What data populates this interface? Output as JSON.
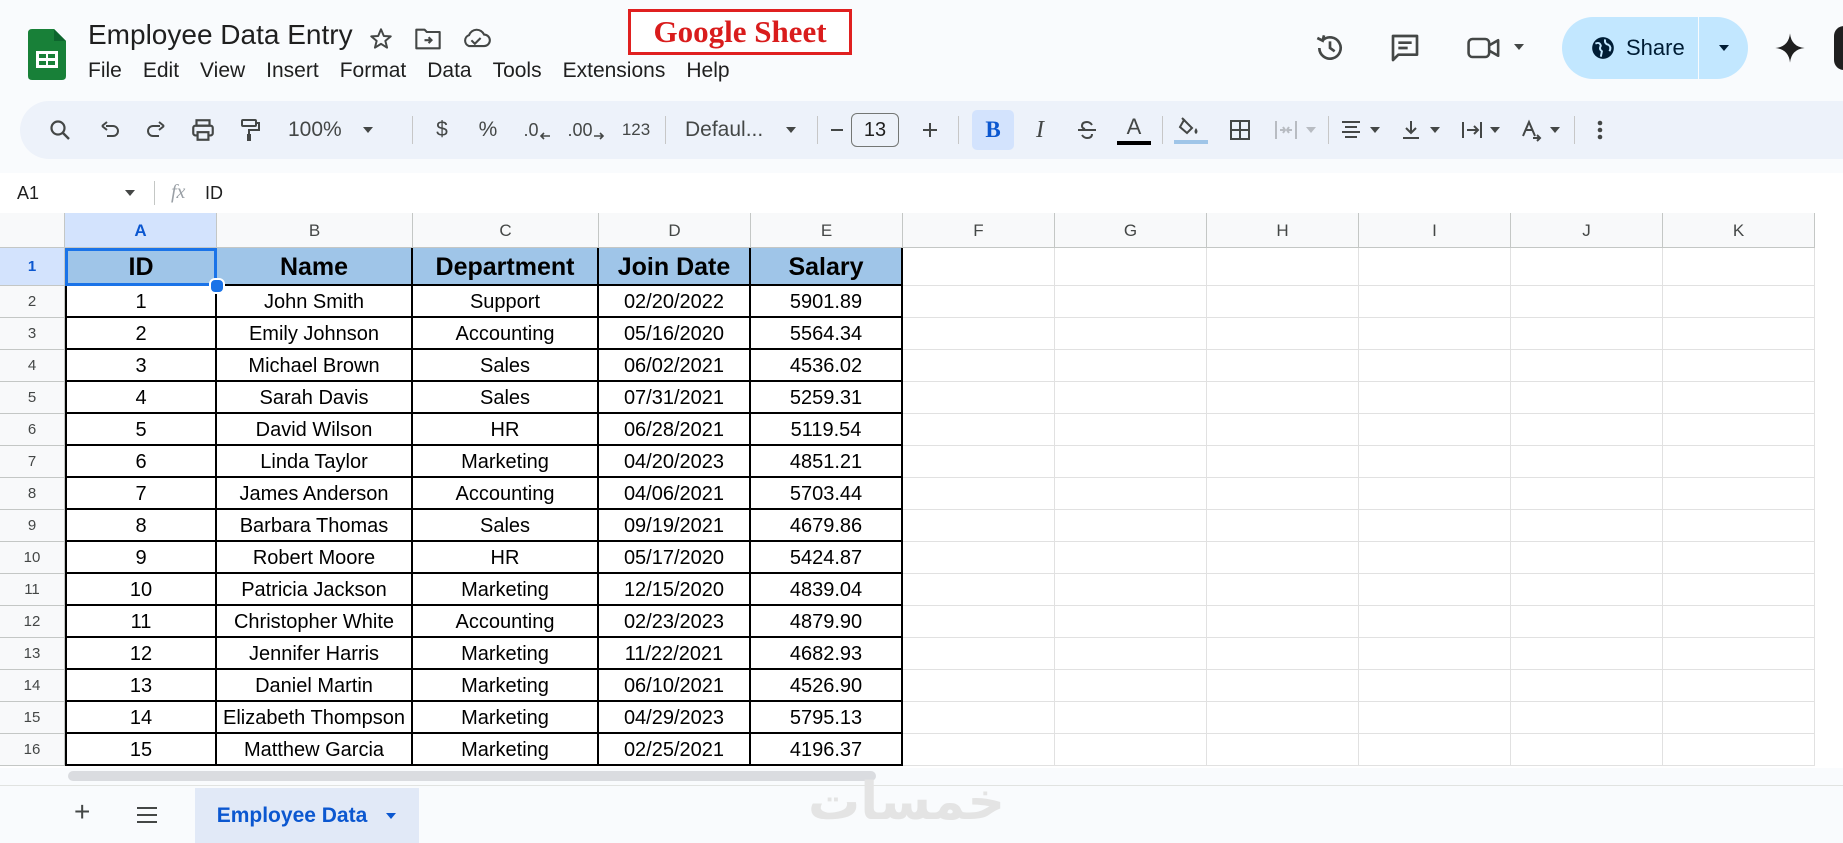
{
  "app": {
    "title": "Employee Data Entry",
    "menu": [
      "File",
      "Edit",
      "View",
      "Insert",
      "Format",
      "Data",
      "Tools",
      "Extensions",
      "Help"
    ],
    "overlay_label": "Google Sheet",
    "share_label": "Share",
    "brand_color": "#188038",
    "accent_color": "#0b57d0"
  },
  "toolbar": {
    "zoom": "100%",
    "currency": "$",
    "percent": "%",
    "decrease_decimal": ".0",
    "increase_decimal": ".00",
    "number_format": "123",
    "font": "Defaul...",
    "font_size": "13",
    "bold": "B",
    "italic": "I",
    "text_color_glyph": "A",
    "icons": [
      "search-icon",
      "undo-icon",
      "redo-icon",
      "print-icon",
      "paint-format-icon",
      "strikethrough-icon",
      "fill-color-icon",
      "borders-icon",
      "merge-icon",
      "align-icon",
      "valign-icon",
      "wrap-icon",
      "rotate-icon",
      "more-icon"
    ]
  },
  "formula_bar": {
    "cell_ref": "A1",
    "fx": "fx",
    "value": "ID"
  },
  "grid": {
    "columns": [
      "A",
      "B",
      "C",
      "D",
      "E",
      "F",
      "G",
      "H",
      "I",
      "J",
      "K"
    ],
    "rows": [
      "1",
      "2",
      "3",
      "4",
      "5",
      "6",
      "7",
      "8",
      "9",
      "10",
      "11",
      "12",
      "13",
      "14",
      "15",
      "16"
    ],
    "headers": [
      "ID",
      "Name",
      "Department",
      "Join Date",
      "Salary"
    ],
    "data": [
      [
        "1",
        "John Smith",
        "Support",
        "02/20/2022",
        "5901.89"
      ],
      [
        "2",
        "Emily Johnson",
        "Accounting",
        "05/16/2020",
        "5564.34"
      ],
      [
        "3",
        "Michael Brown",
        "Sales",
        "06/02/2021",
        "4536.02"
      ],
      [
        "4",
        "Sarah Davis",
        "Sales",
        "07/31/2021",
        "5259.31"
      ],
      [
        "5",
        "David Wilson",
        "HR",
        "06/28/2021",
        "5119.54"
      ],
      [
        "6",
        "Linda Taylor",
        "Marketing",
        "04/20/2023",
        "4851.21"
      ],
      [
        "7",
        "James Anderson",
        "Accounting",
        "04/06/2021",
        "5703.44"
      ],
      [
        "8",
        "Barbara Thomas",
        "Sales",
        "09/19/2021",
        "4679.86"
      ],
      [
        "9",
        "Robert Moore",
        "HR",
        "05/17/2020",
        "5424.87"
      ],
      [
        "10",
        "Patricia Jackson",
        "Marketing",
        "12/15/2020",
        "4839.04"
      ],
      [
        "11",
        "Christopher White",
        "Accounting",
        "02/23/2023",
        "4879.90"
      ],
      [
        "12",
        "Jennifer Harris",
        "Marketing",
        "11/22/2021",
        "4682.93"
      ],
      [
        "13",
        "Daniel Martin",
        "Marketing",
        "06/10/2021",
        "4526.90"
      ],
      [
        "14",
        "Elizabeth Thompson",
        "Marketing",
        "04/29/2023",
        "5795.13"
      ],
      [
        "15",
        "Matthew Garcia",
        "Marketing",
        "02/25/2021",
        "4196.37"
      ]
    ],
    "header_fill": "#9fc5e8"
  },
  "sheets": {
    "add_label": "+",
    "active_tab": "Employee Data"
  },
  "watermark": "خمسات"
}
